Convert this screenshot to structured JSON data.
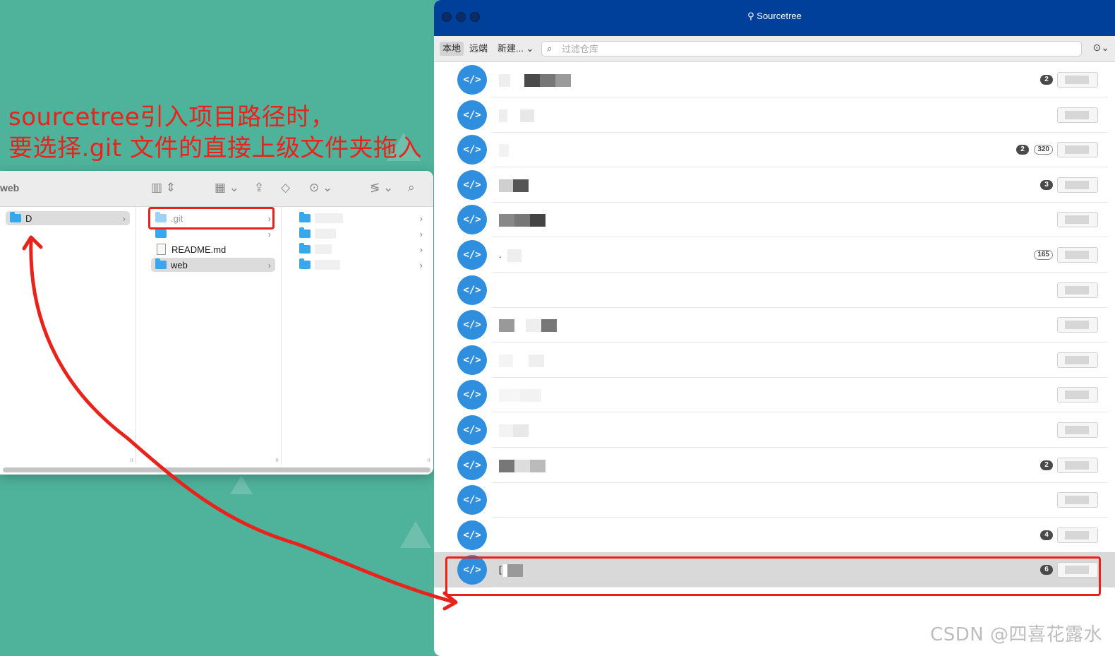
{
  "annotation": {
    "line1": "sourcetree引入项目路径时，",
    "line2": "要选择.git 文件的直接上级文件夹拖入",
    "color": "#e8231c"
  },
  "finder": {
    "title": "web",
    "column1": [
      {
        "label": "D",
        "selected": true
      }
    ],
    "column2": [
      {
        "label": ".git",
        "type": "folder",
        "faded": true,
        "highlighted": true
      },
      {
        "label": "",
        "type": "folder"
      },
      {
        "label": "README.md",
        "type": "file"
      },
      {
        "label": "web",
        "type": "folder",
        "selected": true
      }
    ],
    "column3_count": 4
  },
  "sourcetree": {
    "title": "Sourcetree",
    "tabs": {
      "local": "本地",
      "remote": "远端",
      "new": "新建..."
    },
    "search": {
      "placeholder": "过滤仓库"
    },
    "repos": [
      {
        "name_initial": "",
        "badges": [
          "2"
        ]
      },
      {
        "name_initial": "",
        "badges": []
      },
      {
        "name_initial": "",
        "badges": [
          "2",
          "320"
        ]
      },
      {
        "name_initial": "",
        "badges": [
          "3"
        ]
      },
      {
        "name_initial": "",
        "badges": []
      },
      {
        "name_initial": ".",
        "badges": [
          "165"
        ]
      },
      {
        "name_initial": "",
        "badges": []
      },
      {
        "name_initial": "",
        "badges": []
      },
      {
        "name_initial": "",
        "badges": []
      },
      {
        "name_initial": "",
        "badges": []
      },
      {
        "name_initial": "",
        "badges": []
      },
      {
        "name_initial": "",
        "badges": [
          "2"
        ]
      },
      {
        "name_initial": "",
        "badges": []
      },
      {
        "name_initial": "",
        "badges": [
          "4"
        ]
      },
      {
        "name_initial": "[",
        "badges": [
          "6"
        ],
        "selected": true
      }
    ]
  },
  "watermark": "CSDN @四喜花露水"
}
